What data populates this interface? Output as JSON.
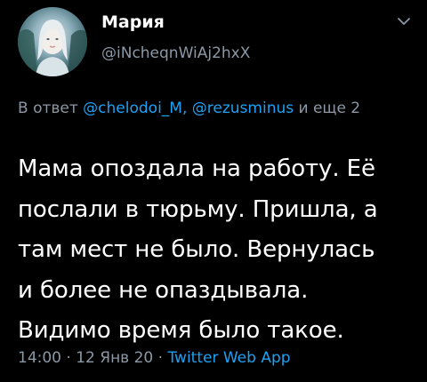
{
  "author": {
    "name": "Мария",
    "handle": "@iNcheqnWiAj2hxX"
  },
  "reply": {
    "prefix": "В ответ",
    "mention_1": "@chelodoi_M,",
    "mention_2": "@rezusminus",
    "suffix": "и еще 2"
  },
  "tweet": {
    "lines": [
      "Мама опоздала на работу. Её",
      "послали в тюрьму. Пришла, а",
      "там мест не было. Вернулась",
      "и более не опаздывала.",
      "Видимо время было такое."
    ]
  },
  "meta": {
    "time": "14:00",
    "sep_1": "·",
    "date": "12 Янв 20",
    "sep_2": "·",
    "app": "Twitter Web App"
  },
  "colors": {
    "background": "#000000",
    "text": "#ffffff",
    "secondary": "#8b98a5",
    "link": "#1da1f2"
  },
  "icons": {
    "menu": "chevron-down-icon"
  }
}
